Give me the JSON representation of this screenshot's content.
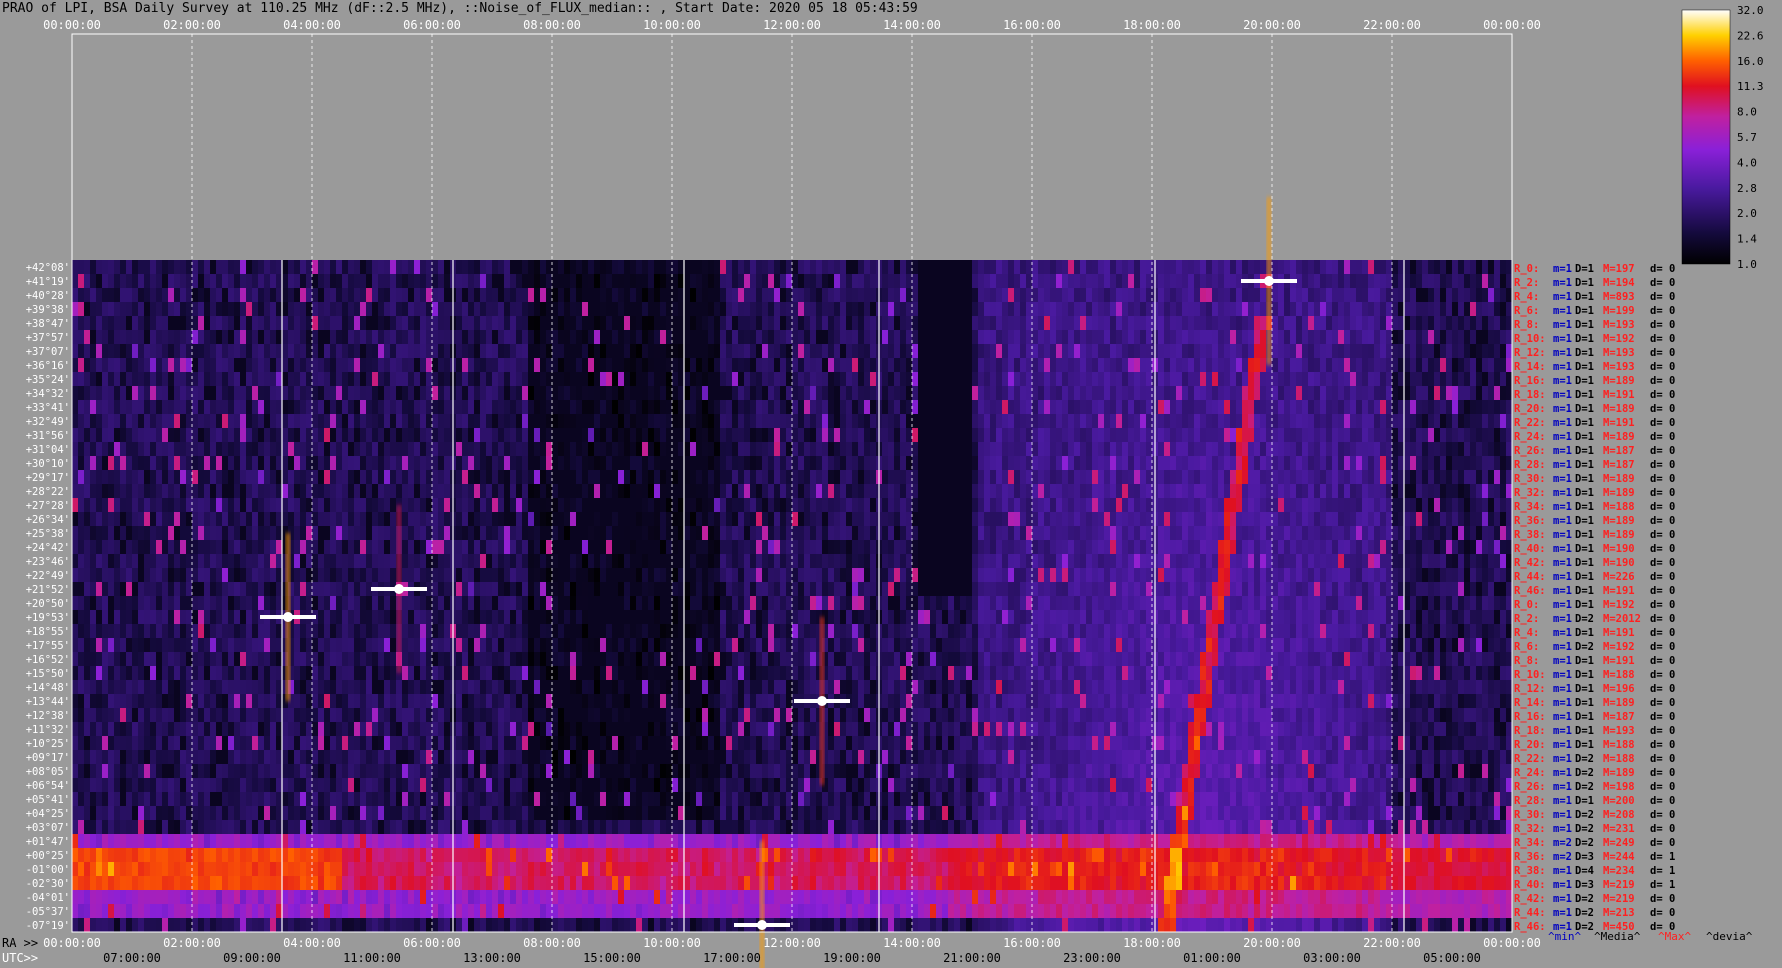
{
  "header": {
    "title": "PRAO of LPI, BSA Daily Survey at 110.25 MHz (dF::2.5 MHz), ::Noise_of_FLUX_median:: , Start Date: 2020 05 18 05:43:59"
  },
  "axes": {
    "top_ticks": [
      "00:00:00",
      "02:00:00",
      "04:00:00",
      "06:00:00",
      "08:00:00",
      "10:00:00",
      "12:00:00",
      "14:00:00",
      "16:00:00",
      "18:00:00",
      "20:00:00",
      "22:00:00",
      "00:00:00"
    ],
    "ra_label": "RA >>",
    "ra_ticks": [
      "00:00:00",
      "02:00:00",
      "04:00:00",
      "06:00:00",
      "08:00:00",
      "10:00:00",
      "12:00:00",
      "14:00:00",
      "16:00:00",
      "18:00:00",
      "20:00:00",
      "22:00:00",
      "00:00:00"
    ],
    "utc_label": "UTC>>",
    "utc_ticks": [
      "07:00:00",
      "09:00:00",
      "11:00:00",
      "13:00:00",
      "15:00:00",
      "17:00:00",
      "19:00:00",
      "21:00:00",
      "23:00:00",
      "01:00:00",
      "03:00:00",
      "05:00:00"
    ],
    "ra_range": [
      0,
      24
    ],
    "declinations": [
      "+42°08'",
      "+41°19'",
      "+40°28'",
      "+39°38'",
      "+38°47'",
      "+37°57'",
      "+37°07'",
      "+36°16'",
      "+35°24'",
      "+34°32'",
      "+33°41'",
      "+32°49'",
      "+31°56'",
      "+31°04'",
      "+30°10'",
      "+29°17'",
      "+28°22'",
      "+27°28'",
      "+26°34'",
      "+25°38'",
      "+24°42'",
      "+23°46'",
      "+22°49'",
      "+21°52'",
      "+20°50'",
      "+19°53'",
      "+18°55'",
      "+17°55'",
      "+16°52'",
      "+15°50'",
      "+14°48'",
      "+13°44'",
      "+12°38'",
      "+11°32'",
      "+10°25'",
      "+09°17'",
      "+08°05'",
      "+06°54'",
      "+05°41'",
      "+04°25'",
      "+03°07'",
      "+01°47'",
      "+00°25'",
      "-01°00'",
      "-02°30'",
      "-04°01'",
      "-05°37'",
      "-07°19'"
    ]
  },
  "beams": [
    {
      "label": "R_0:",
      "m": "m=1",
      "D": "D=1",
      "M": "M=197",
      "d": "d= 0"
    },
    {
      "label": "R_2:",
      "m": "m=1",
      "D": "D=1",
      "M": "M=194",
      "d": "d= 0"
    },
    {
      "label": "R_4:",
      "m": "m=1",
      "D": "D=1",
      "M": "M=893",
      "d": "d= 0"
    },
    {
      "label": "R_6:",
      "m": "m=1",
      "D": "D=1",
      "M": "M=199",
      "d": "d= 0"
    },
    {
      "label": "R_8:",
      "m": "m=1",
      "D": "D=1",
      "M": "M=193",
      "d": "d= 0"
    },
    {
      "label": "R_10:",
      "m": "m=1",
      "D": "D=1",
      "M": "M=192",
      "d": "d= 0"
    },
    {
      "label": "R_12:",
      "m": "m=1",
      "D": "D=1",
      "M": "M=193",
      "d": "d= 0"
    },
    {
      "label": "R_14:",
      "m": "m=1",
      "D": "D=1",
      "M": "M=193",
      "d": "d= 0"
    },
    {
      "label": "R_16:",
      "m": "m=1",
      "D": "D=1",
      "M": "M=189",
      "d": "d= 0"
    },
    {
      "label": "R_18:",
      "m": "m=1",
      "D": "D=1",
      "M": "M=191",
      "d": "d= 0"
    },
    {
      "label": "R_20:",
      "m": "m=1",
      "D": "D=1",
      "M": "M=189",
      "d": "d= 0"
    },
    {
      "label": "R_22:",
      "m": "m=1",
      "D": "D=1",
      "M": "M=191",
      "d": "d= 0"
    },
    {
      "label": "R_24:",
      "m": "m=1",
      "D": "D=1",
      "M": "M=189",
      "d": "d= 0"
    },
    {
      "label": "R_26:",
      "m": "m=1",
      "D": "D=1",
      "M": "M=187",
      "d": "d= 0"
    },
    {
      "label": "R_28:",
      "m": "m=1",
      "D": "D=1",
      "M": "M=187",
      "d": "d= 0"
    },
    {
      "label": "R_30:",
      "m": "m=1",
      "D": "D=1",
      "M": "M=189",
      "d": "d= 0"
    },
    {
      "label": "R_32:",
      "m": "m=1",
      "D": "D=1",
      "M": "M=189",
      "d": "d= 0"
    },
    {
      "label": "R_34:",
      "m": "m=1",
      "D": "D=1",
      "M": "M=188",
      "d": "d= 0"
    },
    {
      "label": "R_36:",
      "m": "m=1",
      "D": "D=1",
      "M": "M=189",
      "d": "d= 0"
    },
    {
      "label": "R_38:",
      "m": "m=1",
      "D": "D=1",
      "M": "M=189",
      "d": "d= 0"
    },
    {
      "label": "R_40:",
      "m": "m=1",
      "D": "D=1",
      "M": "M=190",
      "d": "d= 0"
    },
    {
      "label": "R_42:",
      "m": "m=1",
      "D": "D=1",
      "M": "M=190",
      "d": "d= 0"
    },
    {
      "label": "R_44:",
      "m": "m=1",
      "D": "D=1",
      "M": "M=226",
      "d": "d= 0"
    },
    {
      "label": "R_46:",
      "m": "m=1",
      "D": "D=1",
      "M": "M=191",
      "d": "d= 0"
    },
    {
      "label": "R_0:",
      "m": "m=1",
      "D": "D=1",
      "M": "M=192",
      "d": "d= 0"
    },
    {
      "label": "R_2:",
      "m": "m=1",
      "D": "D=2",
      "M": "M=2012",
      "d": "d= 0"
    },
    {
      "label": "R_4:",
      "m": "m=1",
      "D": "D=1",
      "M": "M=191",
      "d": "d= 0"
    },
    {
      "label": "R_6:",
      "m": "m=1",
      "D": "D=2",
      "M": "M=192",
      "d": "d= 0"
    },
    {
      "label": "R_8:",
      "m": "m=1",
      "D": "D=1",
      "M": "M=191",
      "d": "d= 0"
    },
    {
      "label": "R_10:",
      "m": "m=1",
      "D": "D=1",
      "M": "M=188",
      "d": "d= 0"
    },
    {
      "label": "R_12:",
      "m": "m=1",
      "D": "D=1",
      "M": "M=196",
      "d": "d= 0"
    },
    {
      "label": "R_14:",
      "m": "m=1",
      "D": "D=1",
      "M": "M=189",
      "d": "d= 0"
    },
    {
      "label": "R_16:",
      "m": "m=1",
      "D": "D=1",
      "M": "M=187",
      "d": "d= 0"
    },
    {
      "label": "R_18:",
      "m": "m=1",
      "D": "D=1",
      "M": "M=193",
      "d": "d= 0"
    },
    {
      "label": "R_20:",
      "m": "m=1",
      "D": "D=1",
      "M": "M=188",
      "d": "d= 0"
    },
    {
      "label": "R_22:",
      "m": "m=1",
      "D": "D=2",
      "M": "M=188",
      "d": "d= 0"
    },
    {
      "label": "R_24:",
      "m": "m=1",
      "D": "D=2",
      "M": "M=189",
      "d": "d= 0"
    },
    {
      "label": "R_26:",
      "m": "m=1",
      "D": "D=2",
      "M": "M=198",
      "d": "d= 0"
    },
    {
      "label": "R_28:",
      "m": "m=1",
      "D": "D=1",
      "M": "M=200",
      "d": "d= 0"
    },
    {
      "label": "R_30:",
      "m": "m=1",
      "D": "D=2",
      "M": "M=208",
      "d": "d= 0"
    },
    {
      "label": "R_32:",
      "m": "m=1",
      "D": "D=2",
      "M": "M=231",
      "d": "d= 0"
    },
    {
      "label": "R_34:",
      "m": "m=2",
      "D": "D=2",
      "M": "M=249",
      "d": "d= 0"
    },
    {
      "label": "R_36:",
      "m": "m=2",
      "D": "D=3",
      "M": "M=244",
      "d": "d= 1"
    },
    {
      "label": "R_38:",
      "m": "m=1",
      "D": "D=4",
      "M": "M=234",
      "d": "d= 1"
    },
    {
      "label": "R_40:",
      "m": "m=1",
      "D": "D=3",
      "M": "M=219",
      "d": "d= 1"
    },
    {
      "label": "R_42:",
      "m": "m=1",
      "D": "D=2",
      "M": "M=219",
      "d": "d= 0"
    },
    {
      "label": "R_44:",
      "m": "m=1",
      "D": "D=2",
      "M": "M=213",
      "d": "d= 0"
    },
    {
      "label": "R_46:",
      "m": "m=1",
      "D": "D=2",
      "M": "M=450",
      "d": "d= 0"
    }
  ],
  "legend": {
    "min": "^min^",
    "media": "^Media^",
    "max": "^Max^",
    "devia": "^devia^"
  },
  "colorbar": {
    "ticks": [
      "32.0",
      "22.6",
      "16.0",
      "11.3",
      "8.0",
      "5.7",
      "4.0",
      "2.8",
      "2.0",
      "1.4",
      "1.0"
    ]
  },
  "chart_data": {
    "type": "heatmap",
    "title": "PRAO of LPI, BSA Daily Survey at 110.25 MHz (dF::2.5 MHz), ::Noise_of_FLUX_median:: , Start Date: 2020 05 18 05:43:59",
    "x_axis": "RA (hours)",
    "x_range": [
      0,
      24
    ],
    "rows": 48,
    "color_scale": "log",
    "color_range": [
      1.0,
      32.0
    ],
    "gap_ra": [
      14.15,
      14.95
    ],
    "gap_rows_upper": [
      0,
      23
    ],
    "gap_rows_lower": [
      24,
      47
    ],
    "bright_sources": [
      {
        "ra": 3.6,
        "dec": "+19°53'",
        "level": 32
      },
      {
        "ra": 5.45,
        "dec": "+21°52'",
        "level": 16
      },
      {
        "ra": 12.5,
        "dec": "+13°44'",
        "level": 22
      },
      {
        "ra": 11.5,
        "dec": "-07°19'",
        "level": 32
      },
      {
        "ra": 19.95,
        "dec": "+41°19'",
        "level": 32
      }
    ],
    "band_rows": [
      41,
      46
    ],
    "band_note": "strong horizontal band near Dec 0 (rows 41-46)"
  },
  "colors": {
    "background": "#9a9a9a",
    "grid": "#ffffff",
    "dec_text": "#ffffff",
    "label_red": "#ff2020",
    "label_blue": "#0000c0",
    "label_dark": "#000000"
  }
}
